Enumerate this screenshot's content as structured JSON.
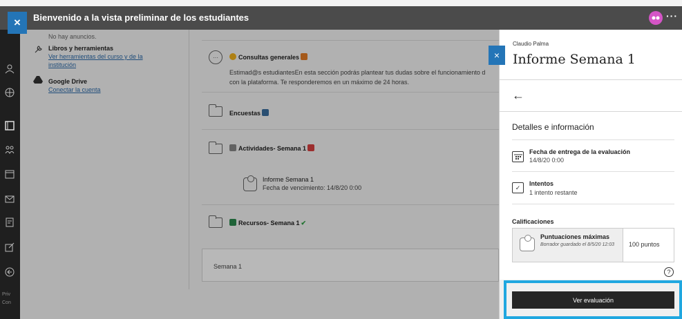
{
  "preview": {
    "title": "Bienvenido a la vista preliminar de los estudiantes",
    "close_icon": "×",
    "more_icon": "···"
  },
  "left_panel": {
    "announcements_empty": "No hay anuncios.",
    "books_title": "Libros y herramientas",
    "books_link_1": "Ver herramientas del curso y de la",
    "books_link_2": "institución",
    "drive_title": "Google Drive",
    "drive_link": "Conectar la cuenta"
  },
  "rail": {
    "footer_1": "Priv",
    "footer_2": "Con"
  },
  "content": {
    "general_title": "Consultas generales",
    "general_body_1": "Estimad@s estudiantesEn esta sección podrás plantear tus dudas sobre el funcionamiento d",
    "general_body_2": "con la plataforma. Te responderemos en un máximo de 24 horas.",
    "surveys_title": "Encuestas",
    "activities_title": "Actividades- Semana 1",
    "report_title": "Informe Semana 1",
    "report_due": "Fecha de vencimiento: 14/8/20 0:00",
    "resources_title": "Recursos- Semana 1",
    "week_label": "Semana 1"
  },
  "panel": {
    "close_icon": "×",
    "user_name": "Claudio Palma",
    "title": "Informe Semana 1",
    "back_icon": "←",
    "section_title": "Detalles e información",
    "due_label": "Fecha de entrega de la evaluación",
    "due_value": "14/8/20 0:00",
    "attempts_label": "Intentos",
    "attempts_value": "1 intento restante",
    "grades_header": "Calificaciones",
    "max_scores_label": "Puntuaciones máximas",
    "draft_note": "Borrador guardado el 8/5/20 12:03",
    "points": "100 puntos",
    "help_icon": "?",
    "cta_label": "Ver evaluación"
  },
  "colors": {
    "accent": "#2475b7",
    "highlight": "#20a7e0",
    "cta_bg": "#262626"
  }
}
